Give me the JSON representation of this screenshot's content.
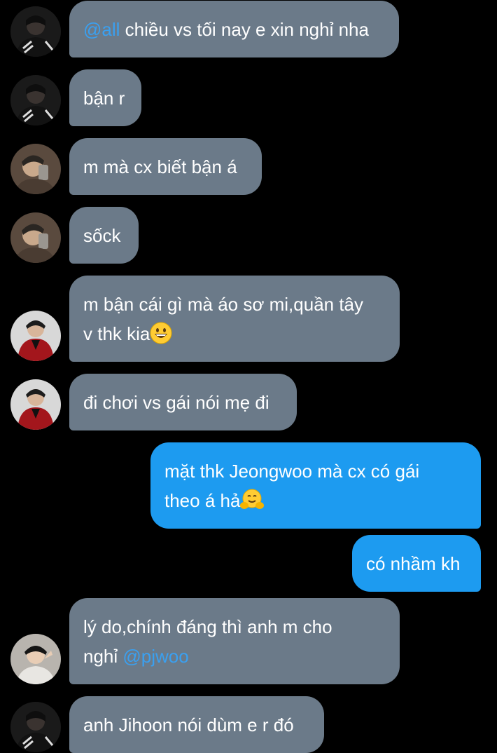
{
  "messages": [
    {
      "side": "in",
      "avatar": "avatar-user-a",
      "mention": "@all",
      "text": " chiều vs tối nay e xin nghỉ nha"
    },
    {
      "side": "in",
      "avatar": "avatar-user-a",
      "text": "bận r"
    },
    {
      "side": "in",
      "avatar": "avatar-user-b",
      "text": "m mà cx biết bận á"
    },
    {
      "side": "in",
      "avatar": "avatar-user-b",
      "text": "sốck"
    },
    {
      "side": "in",
      "avatar": "avatar-user-c",
      "line1": "m bận cái gì mà áo sơ mi,quần tây",
      "line2": "v thk kia",
      "emoji": "grinning-face-emoji"
    },
    {
      "side": "in",
      "avatar": "avatar-user-c",
      "text": "đi chơi vs gái nói mẹ đi"
    },
    {
      "side": "out",
      "line1": "mặt thk Jeongwoo mà cx có gái",
      "line2": "theo á hả",
      "emoji": "hugging-face-emoji"
    },
    {
      "side": "out",
      "text": "có nhầm kh"
    },
    {
      "side": "in",
      "avatar": "avatar-user-d",
      "line1": "lý do,chính đáng thì anh m cho",
      "line2": "nghỉ ",
      "mention": "@pjwoo"
    },
    {
      "side": "in",
      "avatar": "avatar-user-a",
      "text": "anh Jihoon nói dùm e r đó"
    }
  ],
  "colors": {
    "incoming": "#6b7a89",
    "outgoing": "#1d9bf0",
    "mention": "#3aa0f0",
    "background": "#000000"
  }
}
